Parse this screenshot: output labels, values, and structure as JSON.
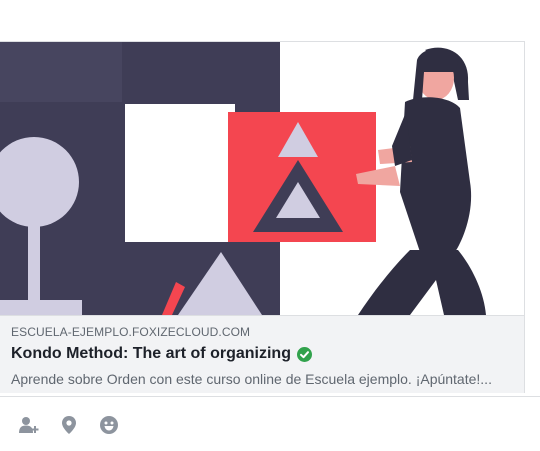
{
  "link_preview": {
    "domain": "ESCUELA-EJEMPLO.FOXIZECLOUD.COM",
    "title": "Kondo Method: The art of organizing",
    "description": "Aprende sobre Orden con este curso online de Escuela ejemplo. ¡Apúntate!..."
  },
  "toolbar": {
    "icons": [
      "tag-friends-icon",
      "location-pin-icon",
      "emoji-icon"
    ]
  },
  "colors": {
    "illustration_dark": "#3f3d56",
    "illustration_light": "#d0cde1",
    "illustration_red": "#f44650",
    "verified_green": "#31a24c",
    "text_primary": "#1d2129",
    "text_secondary": "#606770"
  }
}
